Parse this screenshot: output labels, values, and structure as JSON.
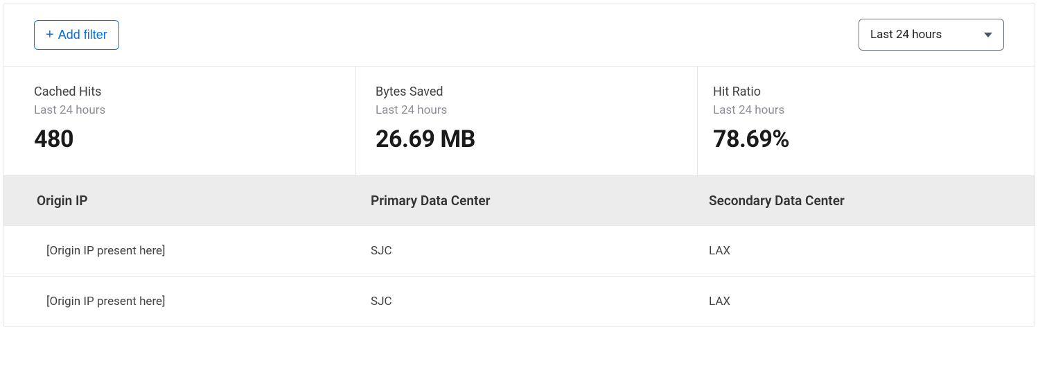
{
  "topbar": {
    "add_filter_label": "Add filter",
    "time_range_label": "Last 24 hours"
  },
  "stats": [
    {
      "title": "Cached Hits",
      "subtitle": "Last 24 hours",
      "value": "480"
    },
    {
      "title": "Bytes Saved",
      "subtitle": "Last 24 hours",
      "value": "26.69 MB"
    },
    {
      "title": "Hit Ratio",
      "subtitle": "Last 24 hours",
      "value": "78.69%"
    }
  ],
  "table": {
    "headers": [
      "Origin IP",
      "Primary Data Center",
      "Secondary Data Center"
    ],
    "rows": [
      {
        "origin_ip": "[Origin IP present here]",
        "primary": "SJC",
        "secondary": "LAX"
      },
      {
        "origin_ip": "[Origin IP present here]",
        "primary": "SJC",
        "secondary": "LAX"
      }
    ]
  }
}
